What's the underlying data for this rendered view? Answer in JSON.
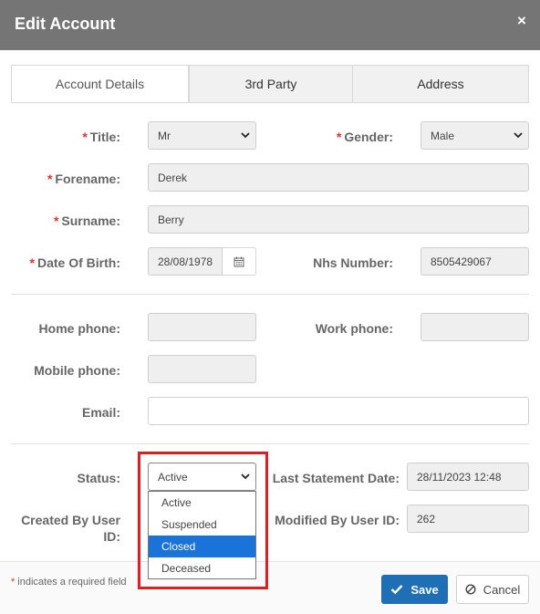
{
  "dialog": {
    "title": "Edit Account",
    "close_glyph": "×"
  },
  "tabs": [
    {
      "label": "Account Details",
      "active": true
    },
    {
      "label": "3rd Party",
      "active": false
    },
    {
      "label": "Address",
      "active": false
    }
  ],
  "required_marker": "*",
  "fields": {
    "title": {
      "label": "Title:",
      "value": "Mr",
      "required": true
    },
    "gender": {
      "label": "Gender:",
      "value": "Male",
      "required": true
    },
    "forename": {
      "label": "Forename:",
      "value": "Derek",
      "required": true
    },
    "surname": {
      "label": "Surname:",
      "value": "Berry",
      "required": true
    },
    "dob": {
      "label": "Date Of Birth:",
      "value": "28/08/1978",
      "required": true
    },
    "nhs": {
      "label": "Nhs Number:",
      "value": "8505429067"
    },
    "home_phone": {
      "label": "Home phone:",
      "value": ""
    },
    "work_phone": {
      "label": "Work phone:",
      "value": ""
    },
    "mobile_phone": {
      "label": "Mobile phone:",
      "value": ""
    },
    "email": {
      "label": "Email:",
      "value": ""
    },
    "status": {
      "label": "Status:",
      "value": "Active",
      "options": [
        "Active",
        "Suspended",
        "Closed",
        "Deceased"
      ],
      "highlighted_option": "Closed"
    },
    "last_statement": {
      "label": "Last Statement Date:",
      "value": "28/11/2023 12:48"
    },
    "created_by": {
      "label": "Created By User ID:",
      "value": ""
    },
    "modified_by": {
      "label": "Modified By User ID:",
      "value": "262"
    }
  },
  "footer": {
    "note": "indicates a required field",
    "save_label": "Save",
    "cancel_label": "Cancel"
  },
  "colors": {
    "header_bg": "#757575",
    "primary": "#1f6fb5",
    "required": "#e0302d",
    "highlight_border": "#dd1f1f",
    "option_highlight": "#1a73d9"
  },
  "icons": {
    "close": "close-icon",
    "calendar": "calendar-icon",
    "save": "check-icon",
    "cancel": "ban-icon",
    "select": "chevron-down-icon"
  }
}
